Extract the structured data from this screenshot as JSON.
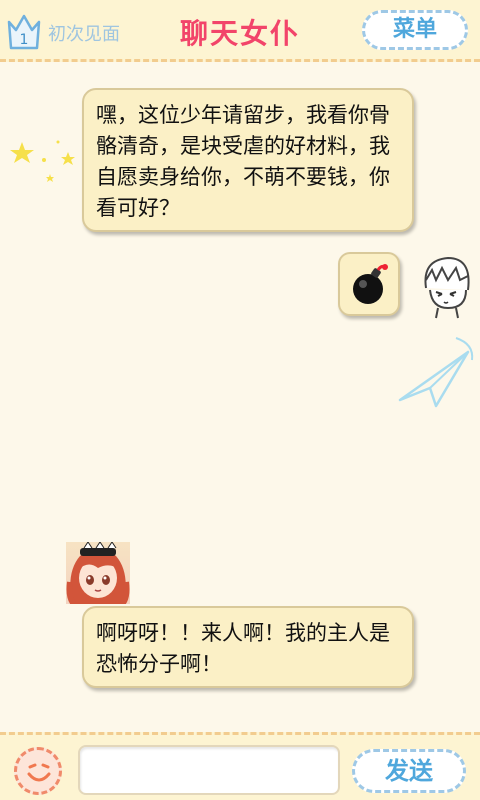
{
  "header": {
    "level_number": "1",
    "level_label": "初次见面",
    "title": "聊天女仆",
    "menu_label": "菜单"
  },
  "messages": [
    {
      "sender": "maid",
      "text": "嘿，这位少年请留步，我看你骨骼清奇，是块受虐的好材料，我自愿卖身给你，不萌不要钱，你看可好？"
    },
    {
      "sender": "user",
      "content": "bomb-icon"
    },
    {
      "sender": "maid",
      "text": "啊呀呀！！来人啊！我的主人是恐怖分子啊！"
    }
  ],
  "input": {
    "value": "",
    "placeholder": ""
  },
  "send_label": "发送",
  "colors": {
    "title": "#f2446a",
    "button_text": "#4fa7dc",
    "bubble_bg": "#fbf0c6",
    "background": "#fdf8ea"
  }
}
